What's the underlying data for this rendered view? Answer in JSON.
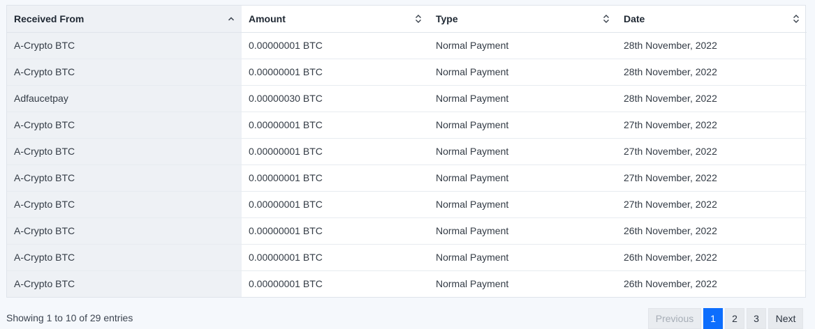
{
  "table": {
    "columns": [
      {
        "label": "Received From",
        "sort": "asc"
      },
      {
        "label": "Amount",
        "sort": "none"
      },
      {
        "label": "Type",
        "sort": "none"
      },
      {
        "label": "Date",
        "sort": "none"
      }
    ],
    "rows": [
      [
        "A-Crypto BTC",
        "0.00000001 BTC",
        "Normal Payment",
        "28th November, 2022"
      ],
      [
        "A-Crypto BTC",
        "0.00000001 BTC",
        "Normal Payment",
        "28th November, 2022"
      ],
      [
        "Adfaucetpay",
        "0.00000030 BTC",
        "Normal Payment",
        "28th November, 2022"
      ],
      [
        "A-Crypto BTC",
        "0.00000001 BTC",
        "Normal Payment",
        "27th November, 2022"
      ],
      [
        "A-Crypto BTC",
        "0.00000001 BTC",
        "Normal Payment",
        "27th November, 2022"
      ],
      [
        "A-Crypto BTC",
        "0.00000001 BTC",
        "Normal Payment",
        "27th November, 2022"
      ],
      [
        "A-Crypto BTC",
        "0.00000001 BTC",
        "Normal Payment",
        "27th November, 2022"
      ],
      [
        "A-Crypto BTC",
        "0.00000001 BTC",
        "Normal Payment",
        "26th November, 2022"
      ],
      [
        "A-Crypto BTC",
        "0.00000001 BTC",
        "Normal Payment",
        "26th November, 2022"
      ],
      [
        "A-Crypto BTC",
        "0.00000001 BTC",
        "Normal Payment",
        "26th November, 2022"
      ]
    ]
  },
  "footer": {
    "info": "Showing 1 to 10 of 29 entries",
    "pagination": {
      "previous": "Previous",
      "pages": [
        "1",
        "2",
        "3"
      ],
      "current": "1",
      "next": "Next"
    }
  },
  "colors": {
    "accent": "#0d6efd",
    "sorted_column_bg": "#eef1f5",
    "page_bg": "#f5f8fc"
  },
  "icons": {
    "sorted_asc": "chevron-up-icon",
    "unsorted": "sort-updown-icon"
  }
}
